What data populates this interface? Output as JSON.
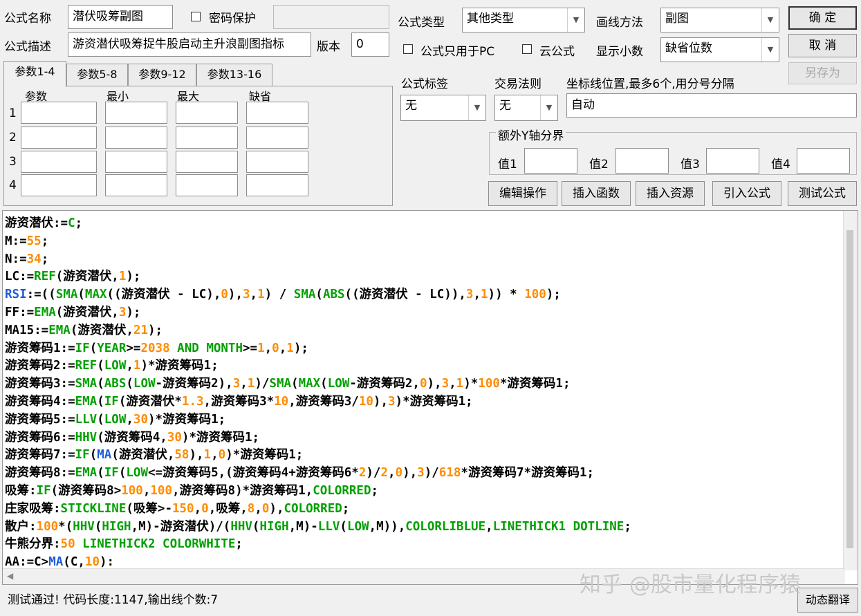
{
  "form": {
    "name_label": "公式名称",
    "name_value": "潜伏吸筹副图",
    "password_label": "密码保护",
    "password_value": "",
    "desc_label": "公式描述",
    "desc_value": "游资潜伏吸筹捉牛股启动主升浪副图指标",
    "version_label": "版本",
    "version_value": "0",
    "type_label": "公式类型",
    "type_value": "其他类型",
    "draw_label": "画线方法",
    "draw_value": "副图",
    "pc_only_label": "公式只用于PC",
    "cloud_label": "云公式",
    "decimal_label": "显示小数",
    "decimal_value": "缺省位数",
    "tag_label": "公式标签",
    "tag_value": "无",
    "rule_label": "交易法则",
    "rule_value": "无",
    "coord_label": "坐标线位置,最多6个,用分号分隔",
    "coord_value": "自动",
    "extra_y_label": "额外Y轴分界",
    "v1_label": "值1",
    "v2_label": "值2",
    "v3_label": "值3",
    "v4_label": "值4"
  },
  "buttons": {
    "ok": "确 定",
    "cancel": "取 消",
    "save_as": "另存为",
    "edit_ops": "编辑操作",
    "insert_func": "插入函数",
    "insert_res": "插入资源",
    "import_formula": "引入公式",
    "test_formula": "测试公式",
    "dynamic_translate": "动态翻译"
  },
  "tabs": [
    "参数1-4",
    "参数5-8",
    "参数9-12",
    "参数13-16"
  ],
  "params": {
    "headers": [
      "参数",
      "最小",
      "最大",
      "缺省"
    ],
    "rows": [
      "1",
      "2",
      "3",
      "4"
    ]
  },
  "colors": {
    "green": "#00a000",
    "orange": "#ff8c00",
    "blue": "#1e5bd8",
    "black": "#000000"
  },
  "code_lines": [
    [
      [
        "k",
        "游资潜伏"
      ],
      [
        "k",
        ":="
      ],
      [
        "g",
        "C"
      ],
      [
        "k",
        ";"
      ]
    ],
    [
      [
        "k",
        "M:="
      ],
      [
        "o",
        "55"
      ],
      [
        "k",
        ";"
      ]
    ],
    [
      [
        "k",
        "N:="
      ],
      [
        "o",
        "34"
      ],
      [
        "k",
        ";"
      ]
    ],
    [
      [
        "k",
        "LC:="
      ],
      [
        "g",
        "REF"
      ],
      [
        "k",
        "(游资潜伏,"
      ],
      [
        "o",
        "1"
      ],
      [
        "k",
        ");"
      ]
    ],
    [
      [
        "b",
        "RSI"
      ],
      [
        "k",
        ":=(("
      ],
      [
        "g",
        "SMA"
      ],
      [
        "k",
        "("
      ],
      [
        "g",
        "MAX"
      ],
      [
        "k",
        "((游资潜伏 - LC),"
      ],
      [
        "o",
        "0"
      ],
      [
        "k",
        "),"
      ],
      [
        "o",
        "3"
      ],
      [
        "k",
        ","
      ],
      [
        "o",
        "1"
      ],
      [
        "k",
        ") / "
      ],
      [
        "g",
        "SMA"
      ],
      [
        "k",
        "("
      ],
      [
        "g",
        "ABS"
      ],
      [
        "k",
        "((游资潜伏 - LC)),"
      ],
      [
        "o",
        "3"
      ],
      [
        "k",
        ","
      ],
      [
        "o",
        "1"
      ],
      [
        "k",
        ")) * "
      ],
      [
        "o",
        "100"
      ],
      [
        "k",
        ");"
      ]
    ],
    [
      [
        "k",
        "FF:="
      ],
      [
        "g",
        "EMA"
      ],
      [
        "k",
        "(游资潜伏,"
      ],
      [
        "o",
        "3"
      ],
      [
        "k",
        ");"
      ]
    ],
    [
      [
        "k",
        "MA15:="
      ],
      [
        "g",
        "EMA"
      ],
      [
        "k",
        "(游资潜伏,"
      ],
      [
        "o",
        "21"
      ],
      [
        "k",
        ");"
      ]
    ],
    [
      [
        "k",
        "游资筹码1:="
      ],
      [
        "g",
        "IF"
      ],
      [
        "k",
        "("
      ],
      [
        "g",
        "YEAR"
      ],
      [
        "k",
        ">="
      ],
      [
        "o",
        "2038"
      ],
      [
        "g",
        " AND "
      ],
      [
        "g",
        "MONTH"
      ],
      [
        "k",
        ">="
      ],
      [
        "o",
        "1"
      ],
      [
        "k",
        ","
      ],
      [
        "o",
        "0"
      ],
      [
        "k",
        ","
      ],
      [
        "o",
        "1"
      ],
      [
        "k",
        ");"
      ]
    ],
    [
      [
        "k",
        "游资筹码2:="
      ],
      [
        "g",
        "REF"
      ],
      [
        "k",
        "("
      ],
      [
        "g",
        "LOW"
      ],
      [
        "k",
        ","
      ],
      [
        "o",
        "1"
      ],
      [
        "k",
        ")*游资筹码1;"
      ]
    ],
    [
      [
        "k",
        "游资筹码3:="
      ],
      [
        "g",
        "SMA"
      ],
      [
        "k",
        "("
      ],
      [
        "g",
        "ABS"
      ],
      [
        "k",
        "("
      ],
      [
        "g",
        "LOW"
      ],
      [
        "k",
        "-游资筹码2),"
      ],
      [
        "o",
        "3"
      ],
      [
        "k",
        ","
      ],
      [
        "o",
        "1"
      ],
      [
        "k",
        ")/"
      ],
      [
        "g",
        "SMA"
      ],
      [
        "k",
        "("
      ],
      [
        "g",
        "MAX"
      ],
      [
        "k",
        "("
      ],
      [
        "g",
        "LOW"
      ],
      [
        "k",
        "-游资筹码2,"
      ],
      [
        "o",
        "0"
      ],
      [
        "k",
        "),"
      ],
      [
        "o",
        "3"
      ],
      [
        "k",
        ","
      ],
      [
        "o",
        "1"
      ],
      [
        "k",
        ")*"
      ],
      [
        "o",
        "100"
      ],
      [
        "k",
        "*游资筹码1;"
      ]
    ],
    [
      [
        "k",
        "游资筹码4:="
      ],
      [
        "g",
        "EMA"
      ],
      [
        "k",
        "("
      ],
      [
        "g",
        "IF"
      ],
      [
        "k",
        "(游资潜伏*"
      ],
      [
        "o",
        "1.3"
      ],
      [
        "k",
        ",游资筹码3*"
      ],
      [
        "o",
        "10"
      ],
      [
        "k",
        ",游资筹码3/"
      ],
      [
        "o",
        "10"
      ],
      [
        "k",
        "),"
      ],
      [
        "o",
        "3"
      ],
      [
        "k",
        ")*游资筹码1;"
      ]
    ],
    [
      [
        "k",
        "游资筹码5:="
      ],
      [
        "g",
        "LLV"
      ],
      [
        "k",
        "("
      ],
      [
        "g",
        "LOW"
      ],
      [
        "k",
        ","
      ],
      [
        "o",
        "30"
      ],
      [
        "k",
        ")*游资筹码1;"
      ]
    ],
    [
      [
        "k",
        "游资筹码6:="
      ],
      [
        "g",
        "HHV"
      ],
      [
        "k",
        "(游资筹码4,"
      ],
      [
        "o",
        "30"
      ],
      [
        "k",
        ")*游资筹码1;"
      ]
    ],
    [
      [
        "k",
        "游资筹码7:="
      ],
      [
        "g",
        "IF"
      ],
      [
        "k",
        "("
      ],
      [
        "b",
        "MA"
      ],
      [
        "k",
        "(游资潜伏,"
      ],
      [
        "o",
        "58"
      ],
      [
        "k",
        "),"
      ],
      [
        "o",
        "1"
      ],
      [
        "k",
        ","
      ],
      [
        "o",
        "0"
      ],
      [
        "k",
        ")*游资筹码1;"
      ]
    ],
    [
      [
        "k",
        "游资筹码8:="
      ],
      [
        "g",
        "EMA"
      ],
      [
        "k",
        "("
      ],
      [
        "g",
        "IF"
      ],
      [
        "k",
        "("
      ],
      [
        "g",
        "LOW"
      ],
      [
        "k",
        "<=游资筹码5,(游资筹码4+游资筹码6*"
      ],
      [
        "o",
        "2"
      ],
      [
        "k",
        ")/"
      ],
      [
        "o",
        "2"
      ],
      [
        "k",
        ","
      ],
      [
        "o",
        "0"
      ],
      [
        "k",
        "),"
      ],
      [
        "o",
        "3"
      ],
      [
        "k",
        ")/"
      ],
      [
        "o",
        "618"
      ],
      [
        "k",
        "*游资筹码7*游资筹码1;"
      ]
    ],
    [
      [
        "k",
        "吸筹:"
      ],
      [
        "g",
        "IF"
      ],
      [
        "k",
        "(游资筹码8>"
      ],
      [
        "o",
        "100"
      ],
      [
        "k",
        ","
      ],
      [
        "o",
        "100"
      ],
      [
        "k",
        ",游资筹码8)*游资筹码1,"
      ],
      [
        "g",
        "COLORRED"
      ],
      [
        "k",
        ";"
      ]
    ],
    [
      [
        "k",
        "庄家吸筹:"
      ],
      [
        "g",
        "STICKLINE"
      ],
      [
        "k",
        "(吸筹>-"
      ],
      [
        "o",
        "150"
      ],
      [
        "k",
        ","
      ],
      [
        "o",
        "0"
      ],
      [
        "k",
        ",吸筹,"
      ],
      [
        "o",
        "8"
      ],
      [
        "k",
        ","
      ],
      [
        "o",
        "0"
      ],
      [
        "k",
        "),"
      ],
      [
        "g",
        "COLORRED"
      ],
      [
        "k",
        ";"
      ]
    ],
    [
      [
        "k",
        "散户:"
      ],
      [
        "o",
        "100"
      ],
      [
        "k",
        "*("
      ],
      [
        "g",
        "HHV"
      ],
      [
        "k",
        "("
      ],
      [
        "g",
        "HIGH"
      ],
      [
        "k",
        ",M)-游资潜伏)/("
      ],
      [
        "g",
        "HHV"
      ],
      [
        "k",
        "("
      ],
      [
        "g",
        "HIGH"
      ],
      [
        "k",
        ",M)-"
      ],
      [
        "g",
        "LLV"
      ],
      [
        "k",
        "("
      ],
      [
        "g",
        "LOW"
      ],
      [
        "k",
        ",M)),"
      ],
      [
        "g",
        "COLORLIBLUE"
      ],
      [
        "k",
        ","
      ],
      [
        "g",
        "LINETHICK1 DOTLINE"
      ],
      [
        "k",
        ";"
      ]
    ],
    [
      [
        "k",
        "牛熊分界:"
      ],
      [
        "o",
        "50"
      ],
      [
        "g",
        " LINETHICK2 COLORWHITE"
      ],
      [
        "k",
        ";"
      ]
    ],
    [
      [
        "k",
        "AA:=C>"
      ],
      [
        "b",
        "MA"
      ],
      [
        "k",
        "(C,"
      ],
      [
        "o",
        "10"
      ],
      [
        "k",
        "):"
      ]
    ]
  ],
  "status": {
    "message": "测试通过! 代码长度:1147,输出线个数:7"
  },
  "watermark": "知乎 @股市量化程序猿"
}
